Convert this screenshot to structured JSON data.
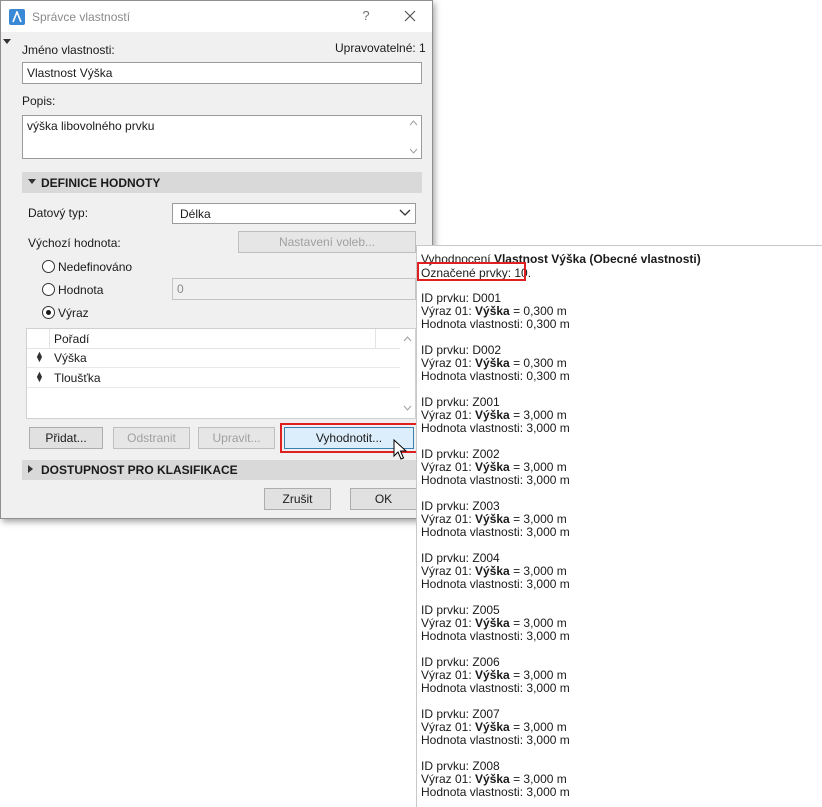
{
  "dialog": {
    "title": "Správce vlastností",
    "help_label": "?",
    "property_name_label": "Jméno vlastnosti:",
    "editable_label": "Upravovatelné: 1",
    "property_name_value": "Vlastnost Výška",
    "description_label": "Popis:",
    "description_value": "výška libovolného prvku",
    "value_definition_section": "DEFINICE HODNOTY",
    "data_type_label": "Datový typ:",
    "data_type_value": "Délka",
    "default_value_label": "Výchozí hodnota:",
    "option_settings_button": "Nastavení voleb...",
    "radio_undefined": "Nedefinováno",
    "radio_value": "Hodnota",
    "value_input": "0",
    "radio_expression": "Výraz",
    "selected_radio": "Výraz",
    "list_header": "Pořadí",
    "list_rows": [
      "Výška",
      "Tloušťka"
    ],
    "add_button": "Přidat...",
    "remove_button": "Odstranit",
    "edit_button": "Upravit...",
    "evaluate_button": "Vyhodnotit...",
    "classification_section": "DOSTUPNOST PRO KLASIFIKACE",
    "cancel_button": "Zrušit",
    "ok_button": "OK"
  },
  "evaluation": {
    "heading_prefix": "Vyhodnocení ",
    "heading_property": "Vlastnost Výška (Obecné vlastnosti)",
    "selected_elements": "Označené prvky: 10.",
    "id_prefix": "ID prvku: ",
    "expr_prefix": "Výraz 01: ",
    "expr_name": "Výška",
    "value_prefix": "Hodnota vlastnosti: ",
    "items": [
      {
        "id": "D001",
        "expr": " = 0,300 m",
        "value": "0,300 m"
      },
      {
        "id": "D002",
        "expr": " = 0,300 m",
        "value": "0,300 m"
      },
      {
        "id": "Z001",
        "expr": " = 3,000 m",
        "value": "3,000 m"
      },
      {
        "id": "Z002",
        "expr": " = 3,000 m",
        "value": "3,000 m"
      },
      {
        "id": "Z003",
        "expr": " = 3,000 m",
        "value": "3,000 m"
      },
      {
        "id": "Z004",
        "expr": " = 3,000 m",
        "value": "3,000 m"
      },
      {
        "id": "Z005",
        "expr": " = 3,000 m",
        "value": "3,000 m"
      },
      {
        "id": "Z006",
        "expr": " = 3,000 m",
        "value": "3,000 m"
      },
      {
        "id": "Z007",
        "expr": " = 3,000 m",
        "value": "3,000 m"
      },
      {
        "id": "Z008",
        "expr": " = 3,000 m",
        "value": "3,000 m"
      }
    ]
  },
  "colors": {
    "highlight": "#e02020",
    "section_bar": "#d9d9d9",
    "focused_button": "#dceefb"
  }
}
